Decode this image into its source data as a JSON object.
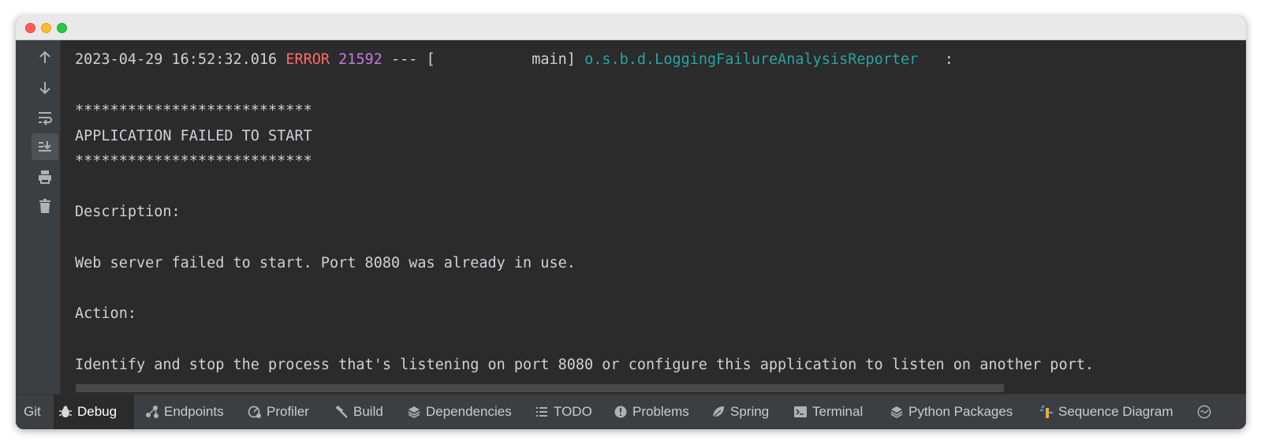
{
  "console": {
    "log_line": {
      "timestamp": "2023-04-29 16:52:32.016",
      "level": "ERROR",
      "pid": "21592",
      "separator": "--- [",
      "thread": "           main]",
      "logger": "o.s.b.d.LoggingFailureAnalysisReporter",
      "colon": ":"
    },
    "stars_top": "***************************",
    "heading": "APPLICATION FAILED TO START",
    "stars_bottom": "***************************",
    "description_label": "Description:",
    "description_text": "Web server failed to start. Port 8080 was already in use.",
    "action_label": "Action:",
    "action_text": "Identify and stop the process that's listening on port 8080 or configure this application to listen on another port."
  },
  "toolbar": {
    "icons": [
      "arrow-up-icon",
      "arrow-down-icon",
      "soft-wrap-icon",
      "scroll-to-end-icon",
      "print-icon",
      "trash-icon"
    ]
  },
  "bottom_tabs": [
    {
      "label": "Git",
      "icon": ""
    },
    {
      "label": "Debug",
      "icon": "bug-icon",
      "active": true
    },
    {
      "label": "Endpoints",
      "icon": "endpoints-icon"
    },
    {
      "label": "Profiler",
      "icon": "profiler-icon"
    },
    {
      "label": "Build",
      "icon": "hammer-icon"
    },
    {
      "label": "Dependencies",
      "icon": "layers-icon"
    },
    {
      "label": "TODO",
      "icon": "list-icon"
    },
    {
      "label": "Problems",
      "icon": "warning-icon"
    },
    {
      "label": "Spring",
      "icon": "leaf-icon"
    },
    {
      "label": "Terminal",
      "icon": "terminal-icon"
    },
    {
      "label": "Python Packages",
      "icon": "layers-icon"
    },
    {
      "label": "Sequence Diagram",
      "icon": "sequence-icon"
    }
  ],
  "colors": {
    "error": "#ff6b68",
    "pid": "#c678dd",
    "logger": "#2aa3a3",
    "console_bg": "#2b2b2b",
    "panel_bg": "#3c3f41"
  }
}
